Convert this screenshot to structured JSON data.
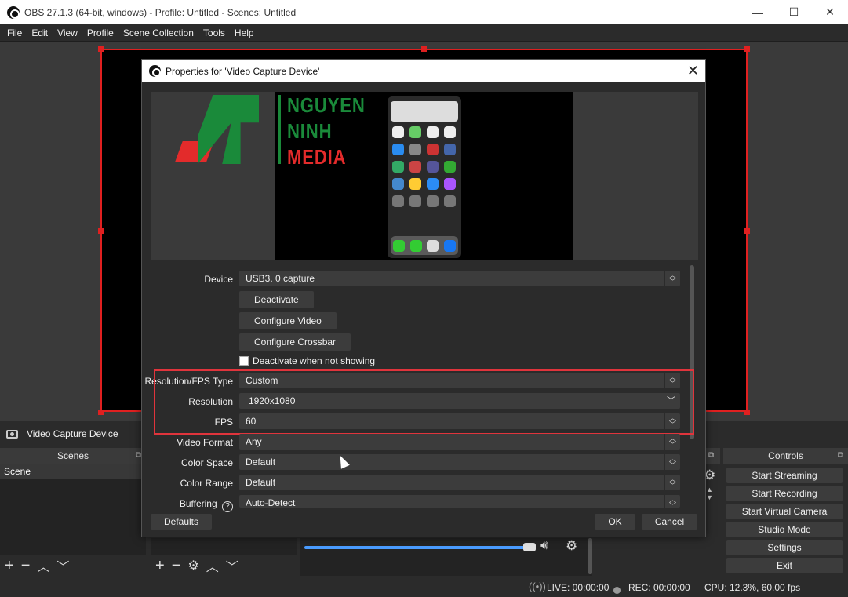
{
  "window": {
    "title": "OBS 27.1.3 (64-bit, windows) - Profile: Untitled - Scenes: Untitled",
    "minimize": "—",
    "maximize": "☐",
    "close": "✕"
  },
  "menu": [
    "File",
    "Edit",
    "View",
    "Profile",
    "Scene Collection",
    "Tools",
    "Help"
  ],
  "source_bar": {
    "label": "Video Capture Device"
  },
  "docks": {
    "scenes": {
      "title": "Scenes",
      "items": [
        "Scene"
      ]
    },
    "controls": {
      "title": "Controls",
      "buttons": [
        "Start Streaming",
        "Start Recording",
        "Start Virtual Camera",
        "Studio Mode",
        "Settings",
        "Exit"
      ]
    }
  },
  "status": {
    "live": "LIVE: 00:00:00",
    "rec": "REC: 00:00:00",
    "cpu": "CPU: 12.3%, 60.00 fps"
  },
  "dialog": {
    "title": "Properties for 'Video Capture Device'",
    "preview_logo": {
      "line1": "NGUYEN",
      "line2": "NINH",
      "line3": "MEDIA"
    },
    "device": {
      "label": "Device",
      "value": "USB3. 0 capture"
    },
    "buttons": {
      "deactivate": "Deactivate",
      "configure_video": "Configure Video",
      "configure_crossbar": "Configure Crossbar"
    },
    "deactivate_when_not_showing": "Deactivate when not showing",
    "resolution_fps_type": {
      "label": "Resolution/FPS Type",
      "value": "Custom"
    },
    "resolution": {
      "label": "Resolution",
      "value": "1920x1080"
    },
    "fps": {
      "label": "FPS",
      "value": "60"
    },
    "video_format": {
      "label": "Video Format",
      "value": "Any"
    },
    "color_space": {
      "label": "Color Space",
      "value": "Default"
    },
    "color_range": {
      "label": "Color Range",
      "value": "Default"
    },
    "buffering": {
      "label": "Buffering",
      "value": "Auto-Detect"
    },
    "defaults": "Defaults",
    "ok": "OK",
    "cancel": "Cancel"
  },
  "accent_colors": {
    "selection": "#e02020",
    "highlight_box": "#e0343c",
    "volume": "#4a9cff"
  }
}
